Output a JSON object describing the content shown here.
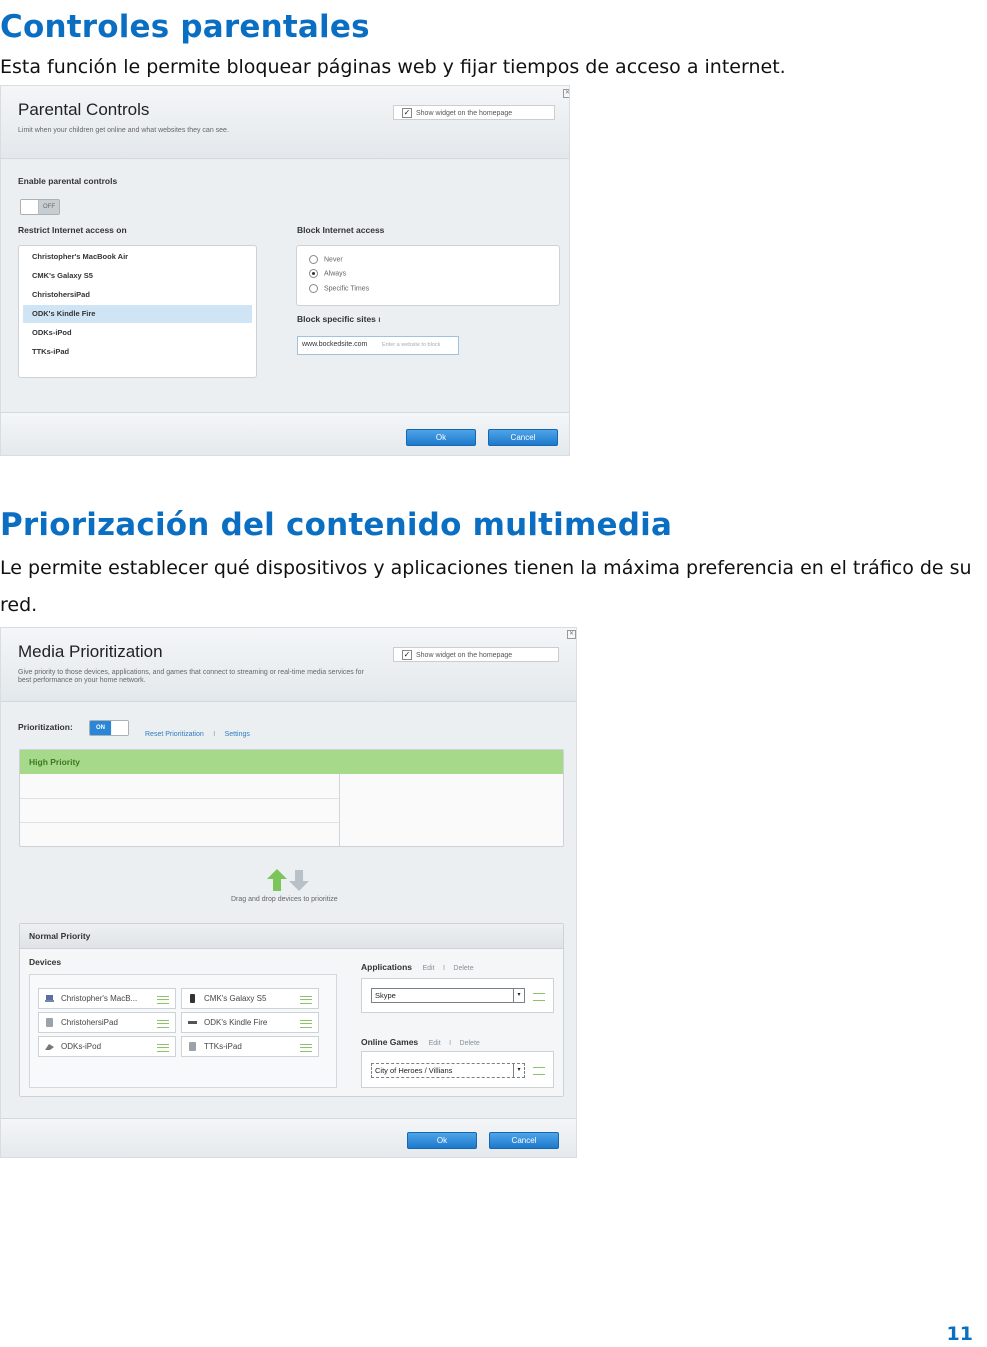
{
  "section1": {
    "heading": "Controles parentales",
    "description": "Esta función le permite bloquear páginas web y fijar tiempos de acceso a internet."
  },
  "parental_controls": {
    "title": "Parental Controls",
    "subtitle": "Limit when your children get online and what websites they can see.",
    "widget_label": "Show widget on the homepage",
    "enable_label": "Enable parental controls",
    "toggle_state": "OFF",
    "restrict_label": "Restrict Internet access on",
    "devices": [
      "Christopher's MacBook Air",
      "CMK's Galaxy S5",
      "ChristohersiPad",
      "ODK's Kindle Fire",
      "ODKs-iPod",
      "TTKs-iPad"
    ],
    "selected_device": "ODK's Kindle Fire",
    "block_access_label": "Block Internet access",
    "block_options": [
      "Never",
      "Always",
      "Specific Times"
    ],
    "block_selected": "Always",
    "block_sites_label": "Block specific sites",
    "site_value": "www.bockedsite.com",
    "site_placeholder": "Enter a website to block",
    "ok_label": "Ok",
    "cancel_label": "Cancel"
  },
  "section2": {
    "heading": "Priorización del contenido multimedia",
    "description": "Le permite establecer qué dispositivos y aplicaciones tienen la máxima preferencia en el tráfico de su red."
  },
  "media_prioritization": {
    "title": "Media Prioritization",
    "subtitle": "Give priority to those devices, applications, and games that connect to streaming or real-time media services for best performance on your home network.",
    "widget_label": "Show widget on the homepage",
    "prioritization_label": "Prioritization:",
    "toggle_state": "ON",
    "reset_link": "Reset Prioritization",
    "settings_link": "Settings",
    "separator": "I",
    "high_priority_label": "High Priority",
    "drag_hint": "Drag and drop devices to prioritize",
    "normal_priority_label": "Normal Priority",
    "devices_label": "Devices",
    "devices": [
      {
        "name": "Christopher's MacB...",
        "icon": "laptop-icon"
      },
      {
        "name": "CMK's Galaxy S5",
        "icon": "phone-icon"
      },
      {
        "name": "ChristohersiPad",
        "icon": "tablet-icon"
      },
      {
        "name": "ODK's Kindle Fire",
        "icon": "kindle-icon"
      },
      {
        "name": "ODKs-iPod",
        "icon": "ipod-icon"
      },
      {
        "name": "TTKs-iPad",
        "icon": "tablet-icon"
      }
    ],
    "applications_label": "Applications",
    "online_games_label": "Online Games",
    "edit_link": "Edit",
    "delete_link": "Delete",
    "application_value": "Skype",
    "game_value": "City of Heroes / Villians",
    "ok_label": "Ok",
    "cancel_label": "Cancel"
  },
  "page_number": "11",
  "colors": {
    "heading": "#0a6fc2",
    "high_priority": "#9dd47f",
    "button": "#2a86d6"
  }
}
